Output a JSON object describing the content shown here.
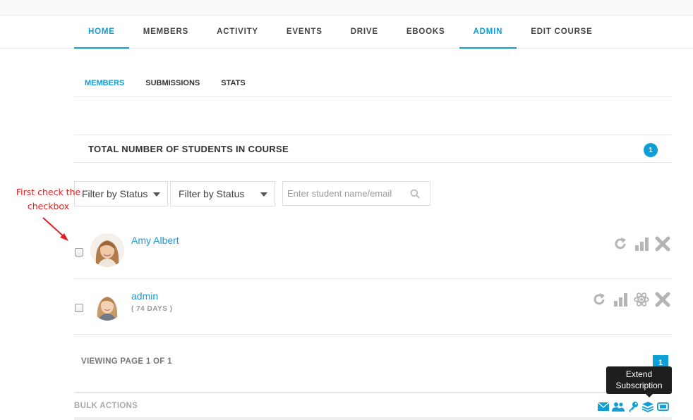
{
  "main_nav": {
    "tabs": [
      {
        "label": "HOME"
      },
      {
        "label": "MEMBERS"
      },
      {
        "label": "ACTIVITY"
      },
      {
        "label": "EVENTS"
      },
      {
        "label": "DRIVE"
      },
      {
        "label": "EBOOKS"
      },
      {
        "label": "ADMIN"
      },
      {
        "label": "EDIT COURSE"
      }
    ]
  },
  "sub_nav": {
    "tabs": [
      {
        "label": "MEMBERS"
      },
      {
        "label": "SUBMISSIONS"
      },
      {
        "label": "STATS"
      }
    ]
  },
  "total_students": {
    "title": "TOTAL NUMBER OF STUDENTS IN COURSE",
    "count": "1"
  },
  "filters": {
    "status_filter_1": "Filter by Status",
    "status_filter_2": "Filter by Status",
    "search_placeholder": "Enter student name/email"
  },
  "annotation": {
    "text": "First check the checkbox",
    "color": "#e02020"
  },
  "students": [
    {
      "name": "Amy Albert",
      "days": ""
    },
    {
      "name": "admin",
      "days": "( 74 DAYS )"
    }
  ],
  "pagination": {
    "text": "VIEWING PAGE 1 OF 1",
    "current_page": "1"
  },
  "tooltip": {
    "text": "Extend Subscription"
  },
  "bulk_actions": {
    "label": "BULK ACTIONS"
  },
  "colors": {
    "accent": "#0d9fd6",
    "link": "#1a9ad6",
    "icon_gray": "#b5b5b5"
  }
}
